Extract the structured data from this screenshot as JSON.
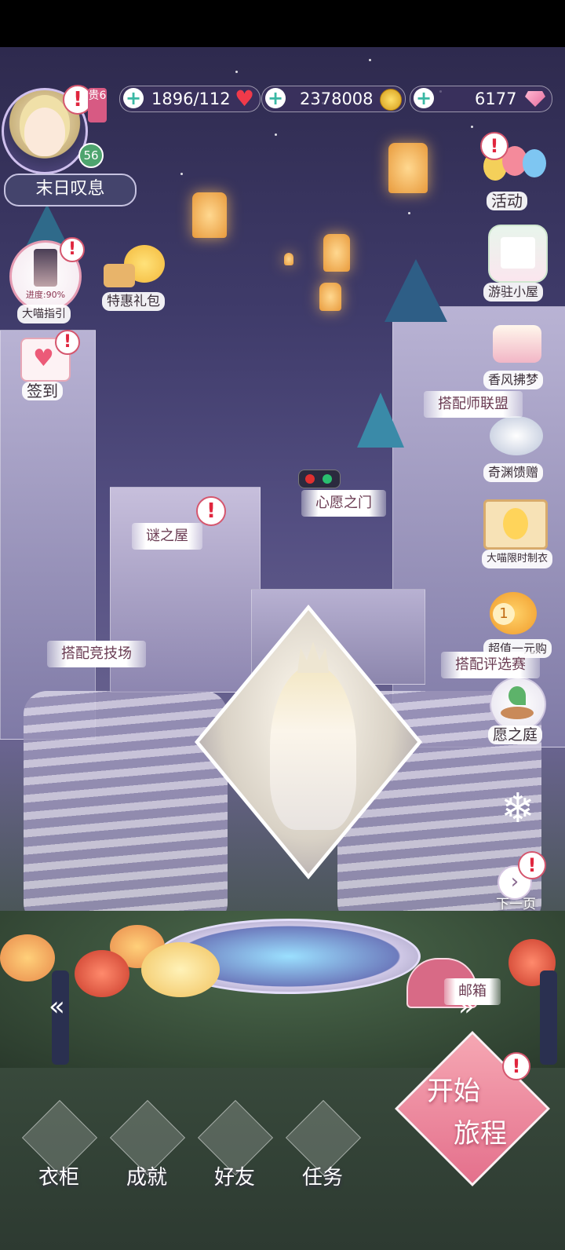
{
  "resources": {
    "stamina": "1896/112",
    "gold": "2378008",
    "diamonds": "6177"
  },
  "player": {
    "name": "末日叹息",
    "level": "56",
    "vip": "贵6"
  },
  "left_menu": {
    "guide_label": "大喵指引",
    "guide_progress": "进度:90%",
    "gift_label": "特惠礼包",
    "signin_label": "签到"
  },
  "right_menu": {
    "activity": "活动",
    "cabin": "游驻小屋",
    "dream": "香风拂梦",
    "abyss_gift": "奇渊馈赠",
    "tailor": "大喵限时制衣",
    "one_yuan": "超值一元购",
    "wish_garden": "愿之庭",
    "next_page": "下一页"
  },
  "scene_tags": {
    "stylist_league": "搭配师联盟",
    "wish_gate": "心愿之门",
    "mystery_house": "谜之屋",
    "arena": "搭配竞技场",
    "judging": "搭配评选赛",
    "mailbox": "邮箱"
  },
  "bottom_nav": {
    "wardrobe": "衣柜",
    "achievement": "成就",
    "friends": "好友",
    "tasks": "任务"
  },
  "start": {
    "line1": "开始",
    "line2": "旅程"
  },
  "colors": {
    "accent_pink": "#e4708c",
    "alert_red": "#e0263e",
    "plus_teal": "#3ab8a4"
  }
}
